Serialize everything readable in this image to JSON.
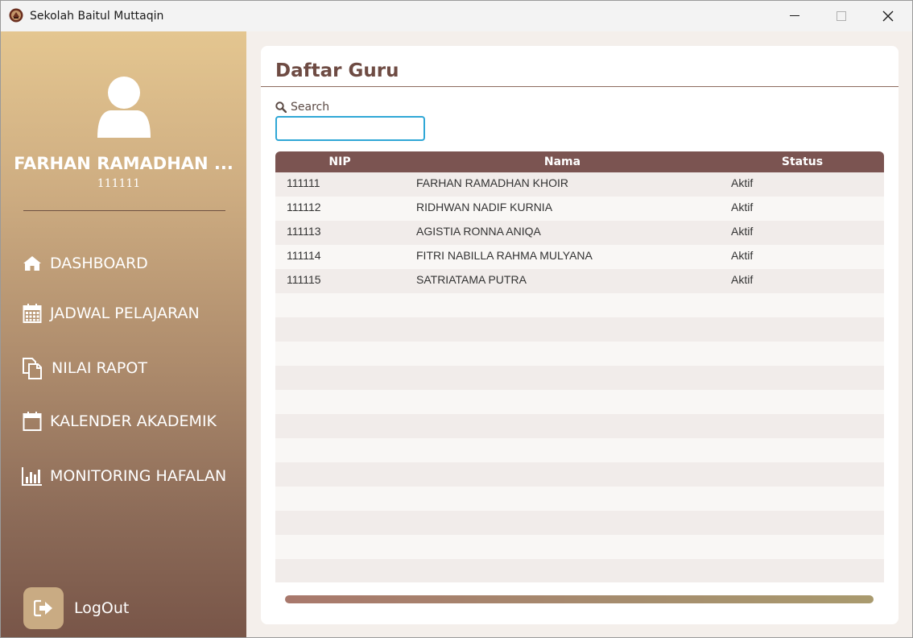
{
  "window": {
    "title": "Sekolah Baitul Muttaqin",
    "controls": [
      "minimize",
      "maximize",
      "close"
    ]
  },
  "sidebar": {
    "user": {
      "name": "FARHAN RAMADHAN ...",
      "nip": "111111"
    },
    "items": [
      {
        "label": "DASHBOARD",
        "icon": "home-icon"
      },
      {
        "label": "JADWAL PELAJARAN",
        "icon": "calendar-grid-icon"
      },
      {
        "label": "NILAI RAPOT",
        "icon": "documents-icon"
      },
      {
        "label": "KALENDER AKADEMIK",
        "icon": "calendar-icon"
      },
      {
        "label": "MONITORING HAFALAN",
        "icon": "bar-chart-icon"
      }
    ],
    "logout_label": "LogOut"
  },
  "main": {
    "title": "Daftar Guru",
    "search": {
      "label": "Search",
      "value": "",
      "placeholder": ""
    },
    "table": {
      "columns": [
        "NIP",
        "Nama",
        "Status"
      ],
      "rows": [
        {
          "nip": "111111",
          "nama": "FARHAN RAMADHAN KHOIR",
          "status": "Aktif"
        },
        {
          "nip": "111112",
          "nama": "RIDHWAN NADIF KURNIA",
          "status": "Aktif"
        },
        {
          "nip": "111113",
          "nama": "AGISTIA RONNA ANIQA",
          "status": "Aktif"
        },
        {
          "nip": "111114",
          "nama": "FITRI NABILLA RAHMA MULYANA",
          "status": "Aktif"
        },
        {
          "nip": "111115",
          "nama": "SATRIATAMA PUTRA",
          "status": "Aktif"
        }
      ]
    }
  },
  "colors": {
    "accent": "#7b5451",
    "title_text": "#6e4b43",
    "search_focus": "#2fa7d6",
    "sidebar_top": "#e4c690",
    "sidebar_bottom": "#785548"
  }
}
